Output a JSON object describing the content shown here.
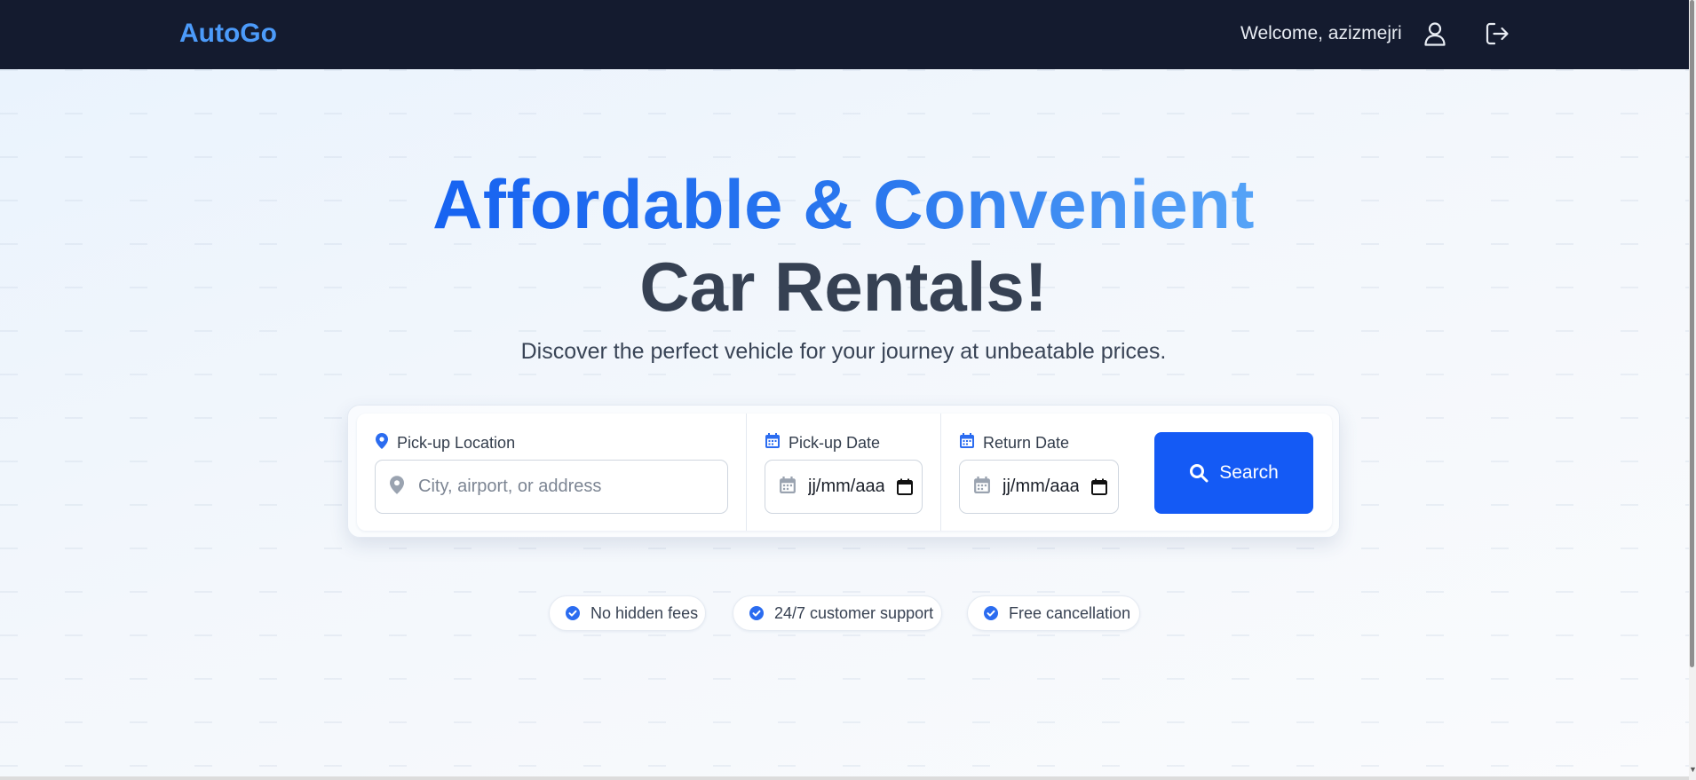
{
  "header": {
    "logo": "AutoGo",
    "welcome_text": "Welcome, azizmejri",
    "icons": [
      "user-icon",
      "logout-icon"
    ]
  },
  "hero": {
    "headline_part1": "Affordable & Convenient",
    "headline_part2": "Car Rentals!",
    "subheadline": "Discover the perfect vehicle for your journey at unbeatable prices."
  },
  "search": {
    "pickup_location": {
      "label": "Pick-up Location",
      "placeholder": "City, airport, or address"
    },
    "pickup_date": {
      "label": "Pick-up Date",
      "value": "jj/mm/aaaa"
    },
    "return_date": {
      "label": "Return Date",
      "value": "jj/mm/aaaa"
    },
    "button_label": "Search"
  },
  "features": [
    {
      "label": "No hidden fees"
    },
    {
      "label": "24/7 customer support"
    },
    {
      "label": "Free cancellation"
    }
  ],
  "colors": {
    "header_bg": "#141b2f",
    "logo": "#4c9bfa",
    "primary_button": "#145af5",
    "headline_blue": "#1763f1",
    "headline_dark": "#364153",
    "icon_blue": "#2b6cf0"
  }
}
